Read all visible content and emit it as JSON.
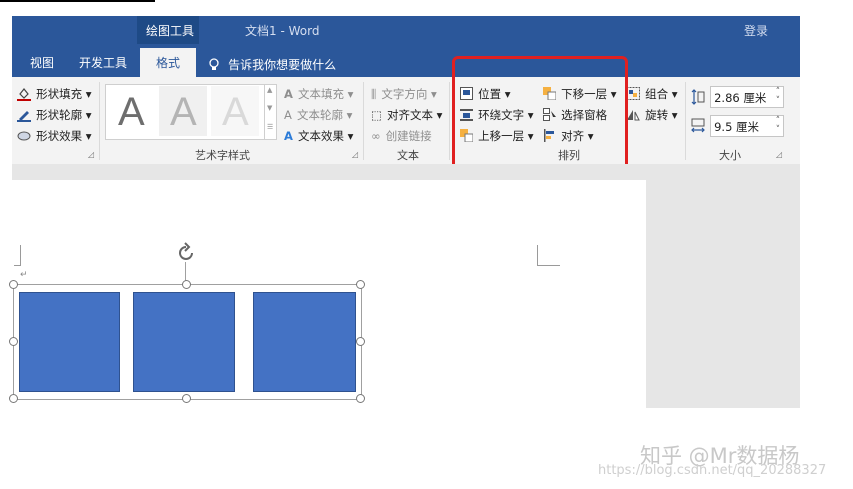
{
  "title_bar": {
    "context_tab": "绘图工具",
    "doc_title": "文档1  -  Word",
    "login": "登录"
  },
  "tabs": [
    {
      "label": "视图"
    },
    {
      "label": "开发工具"
    },
    {
      "label": "格式"
    }
  ],
  "tell_me": "告诉我你想要做什么",
  "shape_styles": {
    "fill": "形状填充",
    "outline": "形状轮廓",
    "effects": "形状效果"
  },
  "wordart": {
    "sample_letter": "A",
    "text_fill": "文本填充",
    "text_outline": "文本轮廓",
    "text_effects": "文本效果",
    "group_label": "艺术字样式"
  },
  "text_group": {
    "direction": "文字方向",
    "align_text": "对齐文本",
    "create_link": "创建链接",
    "group_label": "文本"
  },
  "arrange": {
    "position": "位置",
    "wrap_text": "环绕文字",
    "bring_forward": "上移一层",
    "send_backward": "下移一层",
    "selection_pane": "选择窗格",
    "align": "对齐",
    "group": "组合",
    "rotate": "旋转",
    "group_label": "排列"
  },
  "size": {
    "height": "2.86 厘米",
    "width": "9.5 厘米",
    "group_label": "大小"
  },
  "watermark": {
    "brand": "知乎 @Mr数据杨",
    "url": "https://blog.csdn.net/qq_20288327"
  },
  "colors": {
    "accent": "#2b579a",
    "highlight": "#e02020",
    "shape_fill": "#4472c4"
  }
}
